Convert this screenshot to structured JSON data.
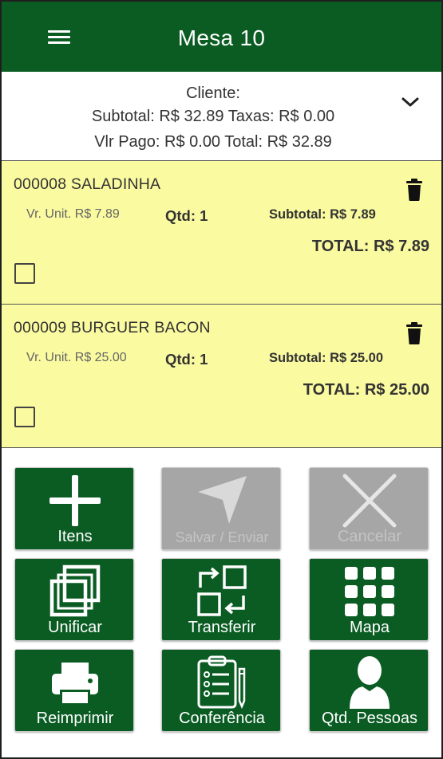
{
  "header": {
    "title": "Mesa 10",
    "menu_icon": "hamburger-menu-icon"
  },
  "summary": {
    "cliente_label": "Cliente:",
    "subtotal_line": "Subtotal: R$ 32.89 Taxas: R$ 0.00",
    "paid_total_line": "Vlr Pago: R$ 0.00 Total: R$ 32.89",
    "expand_icon": "chevron-down-icon"
  },
  "items": [
    {
      "name": "000008 SALADINHA",
      "unit_price": "Vr. Unit. R$ 7.89",
      "qtd": "Qtd: 1",
      "subtotal": "Subtotal: R$ 7.89",
      "total": "TOTAL: R$ 7.89",
      "selected": false
    },
    {
      "name": "000009 BURGUER BACON",
      "unit_price": "Vr. Unit. R$ 25.00",
      "qtd": "Qtd: 1",
      "subtotal": "Subtotal: R$ 25.00",
      "total": "TOTAL: R$ 25.00",
      "selected": false
    }
  ],
  "actions": [
    {
      "label": "Itens",
      "icon": "plus-icon",
      "enabled": true
    },
    {
      "label": "Salvar / Enviar",
      "icon": "send-icon",
      "enabled": false
    },
    {
      "label": "Cancelar",
      "icon": "close-icon",
      "enabled": false
    },
    {
      "label": "Unificar",
      "icon": "unify-icon",
      "enabled": true
    },
    {
      "label": "Transferir",
      "icon": "transfer-icon",
      "enabled": true
    },
    {
      "label": "Mapa",
      "icon": "grid-map-icon",
      "enabled": true
    },
    {
      "label": "Reimprimir",
      "icon": "printer-icon",
      "enabled": true
    },
    {
      "label": "Conferência",
      "icon": "checklist-icon",
      "enabled": true
    },
    {
      "label": "Qtd. Pessoas",
      "icon": "person-icon",
      "enabled": true
    }
  ],
  "colors": {
    "primary_green": "#0a5c23",
    "item_background": "#fafaa0",
    "disabled_gray": "#a6a6a6"
  }
}
